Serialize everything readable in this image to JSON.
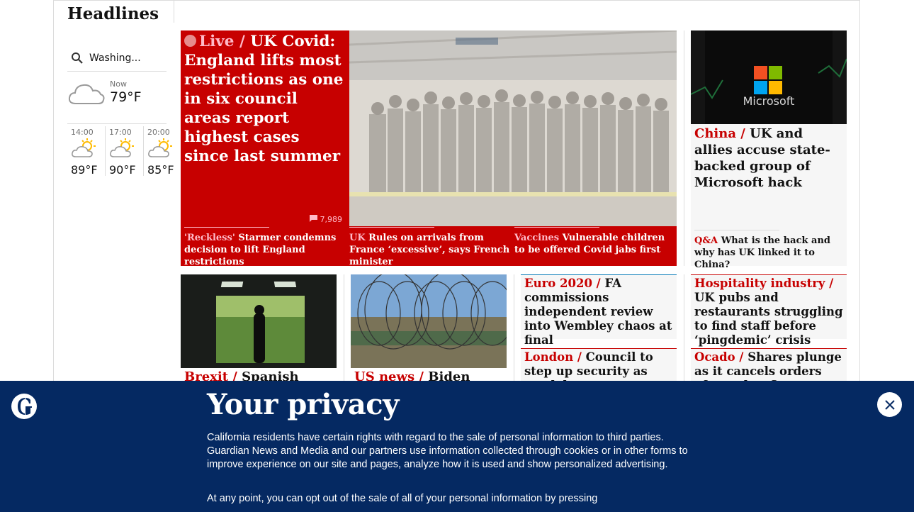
{
  "section": {
    "title": "Headlines"
  },
  "weather": {
    "search_value": "Washing...",
    "now_label": "Now",
    "now_temp": "79°F",
    "forecast": [
      {
        "time": "14:00",
        "temp": "89°F"
      },
      {
        "time": "17:00",
        "temp": "90°F"
      },
      {
        "time": "20:00",
        "temp": "85°F"
      }
    ]
  },
  "lead": {
    "kicker": "Live /",
    "headline": "UK Covid: England lifts most restrictions as one in six council areas report highest cases since last summer",
    "comments": "7,989",
    "sublinks": [
      {
        "kicker": "'Reckless'",
        "text": "Starmer condemns decision to lift England restrictions"
      },
      {
        "kicker": "UK",
        "text": "Rules on arrivals from France ‘excessive’, says French minister"
      },
      {
        "kicker": "Vaccines",
        "text": "Vulnerable children to be offered Covid jabs first"
      }
    ]
  },
  "microsoft_story": {
    "image_text": "Microsoft",
    "kicker": "China /",
    "headline": "UK and allies accuse state-backed group of Microsoft hack",
    "sub_kicker": "Q&A",
    "sub_text": "What is the hack and why has UK linked it to China?"
  },
  "row2": {
    "brexit": {
      "kicker": "Brexit /",
      "headline": "Spanish"
    },
    "usnews": {
      "kicker": "US news /",
      "headline": "Biden"
    },
    "euro": {
      "kicker": "Euro 2020 /",
      "headline": "FA commissions independent review into Wembley chaos at final"
    },
    "hospitality": {
      "kicker": "Hospitality industry /",
      "headline": "UK pubs and restaurants struggling to find staff before ‘pingdemic’ crisis"
    },
    "london": {
      "kicker": "London /",
      "headline": "Council to step up security as vandals target..."
    },
    "ocado": {
      "kicker": "Ocado /",
      "headline": "Shares plunge as it cancels orders after robot fire"
    }
  },
  "privacy": {
    "title": "Your privacy",
    "para1": "California residents have certain rights with regard to the sale of personal information to third parties. Guardian News and Media and our partners use information collected through cookies or in other forms to improve experience on our site and pages, analyze how it is used and show personalized advertising.",
    "para2": "At any point, you can opt out of the sale of all of your personal information by pressing"
  },
  "colors": {
    "news_red": "#c70000",
    "banner_blue": "#052962",
    "kicker_pink": "#ffbac8"
  }
}
